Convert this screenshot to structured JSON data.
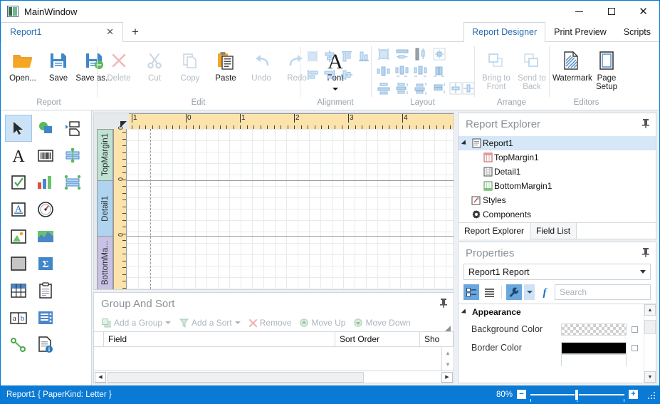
{
  "window": {
    "title": "MainWindow",
    "controls": {
      "minimize": "—",
      "maximize": "□",
      "close": "✕"
    }
  },
  "doc_tabs": {
    "items": [
      {
        "label": "Report1",
        "close": "✕"
      }
    ],
    "new_tab": "+"
  },
  "ribbon_tabs": [
    {
      "label": "Report Designer",
      "active": true
    },
    {
      "label": "Print Preview",
      "active": false
    },
    {
      "label": "Scripts",
      "active": false
    }
  ],
  "ribbon": {
    "groups": [
      {
        "title": "Report",
        "buttons": [
          {
            "label": "Open...",
            "icon": "folder-open-icon",
            "enabled": true
          },
          {
            "label": "Save",
            "icon": "save-icon",
            "enabled": true
          },
          {
            "label": "Save as...",
            "icon": "save-as-icon",
            "enabled": true
          }
        ]
      },
      {
        "title": "Edit",
        "buttons": [
          {
            "label": "Delete",
            "icon": "delete-x-icon",
            "enabled": false
          },
          {
            "label": "Cut",
            "icon": "scissors-icon",
            "enabled": false
          },
          {
            "label": "Copy",
            "icon": "copy-icon",
            "enabled": false
          },
          {
            "label": "Paste",
            "icon": "clipboard-paste-icon",
            "enabled": true
          },
          {
            "label": "Undo",
            "icon": "undo-arrow-icon",
            "enabled": false
          },
          {
            "label": "Redo",
            "icon": "redo-arrow-icon",
            "enabled": false
          },
          {
            "label": "Font",
            "icon": "font-a-icon",
            "enabled": true,
            "dropdown": true
          }
        ]
      },
      {
        "title": "Alignment",
        "icons": [
          "align-to-grid-icon",
          "align-left-icon",
          "align-center-icon",
          "align-right-icon",
          "align-top-icon",
          "align-middle-icon",
          "align-bottom-icon"
        ]
      },
      {
        "title": "Layout",
        "icons": [
          "size-to-grid-icon",
          "make-same-width-icon",
          "make-same-height-icon",
          "make-same-size-icon",
          "make-horizontal-spacing-equal-icon",
          "increase-horizontal-spacing-icon",
          "decrease-horizontal-spacing-icon",
          "remove-horizontal-spacing-icon",
          "make-vertical-spacing-equal-icon",
          "increase-vertical-spacing-icon",
          "decrease-vertical-spacing-icon",
          "remove-vertical-spacing-icon",
          "center-horizontally-icon",
          "center-vertically-icon"
        ]
      },
      {
        "title": "Arrange",
        "buttons": [
          {
            "label": "Bring to Front",
            "icon": "bring-to-front-icon",
            "enabled": false,
            "dropdown": true
          },
          {
            "label": "Send to Back",
            "icon": "send-to-back-icon",
            "enabled": false,
            "dropdown": true
          }
        ]
      },
      {
        "title": "Editors",
        "buttons": [
          {
            "label": "Watermark",
            "icon": "watermark-icon",
            "enabled": true
          },
          {
            "label": "Page Setup",
            "icon": "page-setup-icon",
            "enabled": true
          }
        ]
      }
    ]
  },
  "toolbox": {
    "items": [
      {
        "name": "pointer-tool",
        "selected": true
      },
      {
        "name": "shape-tool",
        "selected": false
      },
      {
        "name": "subreport-tool",
        "selected": false
      },
      {
        "name": "label-tool",
        "selected": false
      },
      {
        "name": "barcode-tool",
        "selected": false
      },
      {
        "name": "table-of-contents-tool",
        "selected": false
      },
      {
        "name": "check-box-tool",
        "selected": false
      },
      {
        "name": "chart-tool",
        "selected": false
      },
      {
        "name": "cross-band-line-tool",
        "selected": false
      },
      {
        "name": "rich-text-tool",
        "selected": false
      },
      {
        "name": "gauge-tool",
        "selected": false
      },
      {
        "name": "picture-box-tool",
        "selected": false
      },
      {
        "name": "sparkline-tool",
        "selected": false
      },
      {
        "name": "panel-tool",
        "selected": false
      },
      {
        "name": "pivot-grid-tool",
        "selected": false
      },
      {
        "name": "table-tool",
        "selected": false
      },
      {
        "name": "card-tool",
        "selected": false
      },
      {
        "name": "page-info-tool",
        "selected": false
      },
      {
        "name": "zip-code-tool",
        "selected": false
      },
      {
        "name": "line-tool",
        "selected": false
      },
      {
        "name": "report-info-tool",
        "selected": false
      }
    ]
  },
  "designer": {
    "h_ruler_labels": [
      "1",
      "0",
      "1",
      "2",
      "3",
      "4"
    ],
    "bands": [
      {
        "label": "TopMargin1",
        "color": "#bfe2d4"
      },
      {
        "label": "Detail1",
        "color": "#aed4ef"
      },
      {
        "label": "BottomMa...",
        "color": "#c8c2e6"
      }
    ],
    "v_ruler_zero": "0"
  },
  "group_and_sort": {
    "title": "Group And Sort",
    "pin": "📌",
    "toolbar": [
      {
        "label": "Add a Group",
        "icon": "add-group-icon",
        "dropdown": true
      },
      {
        "label": "Add a Sort",
        "icon": "add-sort-icon",
        "dropdown": true
      },
      {
        "label": "Remove",
        "icon": "remove-x-icon",
        "dropdown": false
      },
      {
        "label": "Move Up",
        "icon": "move-up-icon",
        "dropdown": false
      },
      {
        "label": "Move Down",
        "icon": "move-down-icon",
        "dropdown": false
      }
    ],
    "columns": [
      "Field",
      "Sort Order",
      "Sho"
    ],
    "rows": []
  },
  "report_explorer": {
    "title": "Report Explorer",
    "tree": [
      {
        "label": "Report1",
        "indent": 0,
        "icon": "report-icon",
        "expander": true,
        "selected": true
      },
      {
        "label": "TopMargin1",
        "indent": 1,
        "icon": "top-margin-band-icon",
        "expander": false,
        "selected": false
      },
      {
        "label": "Detail1",
        "indent": 1,
        "icon": "detail-band-icon",
        "expander": false,
        "selected": false
      },
      {
        "label": "BottomMargin1",
        "indent": 1,
        "icon": "bottom-margin-band-icon",
        "expander": false,
        "selected": false
      },
      {
        "label": "Styles",
        "indent": 0.5,
        "icon": "styles-icon",
        "expander": false,
        "selected": false
      },
      {
        "label": "Components",
        "indent": 0.5,
        "icon": "components-gear-icon",
        "expander": false,
        "selected": false
      }
    ],
    "tabs": [
      {
        "label": "Report Explorer",
        "active": true
      },
      {
        "label": "Field List",
        "active": false
      }
    ]
  },
  "properties": {
    "title": "Properties",
    "selector": "Report1  Report",
    "toolbar": {
      "categorized": "categorized-view-icon",
      "alphabetical": "alphabetical-view-icon",
      "properties": "properties-wrench-icon",
      "events": "events-function-icon"
    },
    "search_placeholder": "Search",
    "categories": [
      {
        "name": "Appearance",
        "rows": [
          {
            "name": "Background Color",
            "value_kind": "transparent",
            "color": "transparent"
          },
          {
            "name": "Border Color",
            "value_kind": "solid",
            "color": "#000000"
          }
        ]
      }
    ]
  },
  "status_bar": {
    "text": "Report1 { PaperKind: Letter }",
    "zoom_percent": "80%",
    "zoom_out": "−",
    "zoom_in": "+",
    "accent_color": "#0b7ad4"
  }
}
